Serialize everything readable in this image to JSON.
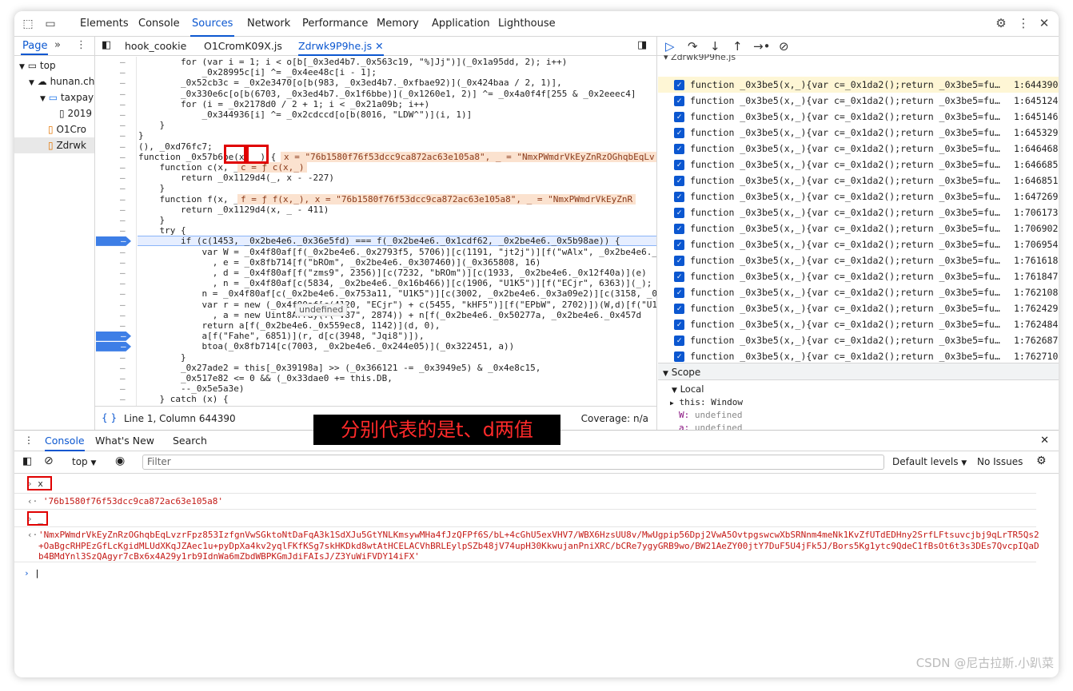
{
  "main_tabs": [
    "Elements",
    "Console",
    "Sources",
    "Network",
    "Performance",
    "Memory",
    "Application",
    "Lighthouse"
  ],
  "active_tab": "Sources",
  "navigator": {
    "tab": "Page",
    "tree": [
      "top",
      "hunan.ch",
      "taxpay",
      "2019",
      "O1Cro",
      "Zdrwk"
    ]
  },
  "editor_tabs": [
    "hook_cookie",
    "O1CromK09X.js",
    "Zdrwk9P9he.js"
  ],
  "code_lines": [
    "        for (var i = 1; i < o[b[_0x3ed4b7._0x563c19, \"%]Jj\")](_0x1a95dd, 2); i++)",
    "            _0x28995c[i] ^= _0x4ee48c[i - 1];",
    "        _0x52cb3c = _0x2e3470[o[b(983, _0x3ed4b7._0xfbae92)](_0x424baa / 2, 1)],",
    "        _0x330e6c[o[b(6703, _0x3ed4b7._0x1f6bbe)](_0x1260e1, 2)] ^= _0x4a0f4f[255 & _0x2eeec4]",
    "        for (i = _0x2178d0 / 2 + 1; i < _0x21a09b; i++)",
    "            _0x344936[i] ^= _0x2cdccd[o[b(8016, \"LDW^\")](i, 1)]",
    "    }",
    "}",
    "(), _0xd76fc7;",
    "function _0x57b6be(x, _) {",
    "    function c(x, _) {",
    "        return _0x1129d4(_, x - -227)",
    "    }",
    "    function f(x, _) {",
    "        return _0x1129d4(x, _ - 411)",
    "    }",
    "    try {",
    "        if (c(1453, _0x2be4e6._0x36e5fd) === f(_0x2be4e6._0x1cdf62, _0x2be4e6._0x5b98ae)) {",
    "            var W = _0x4f80af[f(_0x2be4e6._0x2793f5, 5706)][c(1191, \"jt2j\")][f(\"wAlx\", _0x2be4e6._0",
    "              , e = _0x8fb714[f(\"bROm\", _0x2be4e6._0x307460)](_0x365808, 16)",
    "              , d = _0x4f80af[f(\"zms9\", 2356)][c(7232, \"bROm\")][c(1933, _0x2be4e6._0x12f40a)](e)",
    "              , n = _0x4f80af[c(5834, _0x2be4e6._0x16b466)][c(1906, \"U1K5\")][f(\"ECjr\", 6363)](_);",
    "            n = _0x4f80af[c(_0x2be4e6._0x753a11, \"U1K5\")][c(3002, _0x2be4e6._0x3a09e2)][c(3158, _0",
    "            var r = new (_0x4f80af[c(4120, \"ECjr\") + c(5455, \"kHF5\")][f(\"EPbW\", 2702)])(W,d)[f(\"U1",
    "              , a = new Uint8Array(f(\"V87\", 2874)) + n[f(_0x2be4e6._0x50277a, _0x2be4e6._0x457d",
    "            return a[f(_0x2be4e6._0x559ec8, 1142)](d, 0),",
    "            a[f(\"Fahe\", 6851)](r, d[c(3948, \"Jqi8\")]),",
    "            btoa(_0x8fb714[c(7003, _0x2be4e6._0x244e05)](_0x322451, a))",
    "        }",
    "        _0x27ade2 = this[_0x39198a] >> (_0x366121 -= _0x3949e5) & _0x4e8c15,",
    "        _0x517e82 <= 0 && (_0x33dae0 += this.DB,",
    "        --_0x5e5a3e)",
    "    } catch (x) {",
    "        return \"\""
  ],
  "inline_values": {
    "fn_params": "x = \"76b1580f76f53dcc9ca872ac63e105a8\", _ = \"NmxPWmdrVkEyZnRzOGhqbEqLv",
    "c_def": "c = ƒ c(x,_)",
    "f_def": "f = ƒ f(x,_), x = \"76b1580f76f53dcc9ca872ac63e105a8\", _ = \"NmxPWmdrVkEyZnR"
  },
  "tooltip": "undefined",
  "status": {
    "position": "Line 1, Column 644390",
    "coverage": "Coverage: n/a"
  },
  "breakpoints_file": "Zdrwk9P9he.js",
  "breakpoints": [
    {
      "code": "function _0x3be5(x,_){var c=_0x1da2();return _0x3be5=funct…",
      "loc": "1:644390"
    },
    {
      "code": "function _0x3be5(x,_){var c=_0x1da2();return _0x3be5=funct…",
      "loc": "1:645124"
    },
    {
      "code": "function _0x3be5(x,_){var c=_0x1da2();return _0x3be5=funct…",
      "loc": "1:645146"
    },
    {
      "code": "function _0x3be5(x,_){var c=_0x1da2();return _0x3be5=funct…",
      "loc": "1:645329"
    },
    {
      "code": "function _0x3be5(x,_){var c=_0x1da2();return _0x3be5=funct…",
      "loc": "1:646468"
    },
    {
      "code": "function _0x3be5(x,_){var c=_0x1da2();return _0x3be5=funct…",
      "loc": "1:646685"
    },
    {
      "code": "function _0x3be5(x,_){var c=_0x1da2();return _0x3be5=funct…",
      "loc": "1:646851"
    },
    {
      "code": "function _0x3be5(x,_){var c=_0x1da2();return _0x3be5=funct…",
      "loc": "1:647269"
    },
    {
      "code": "function _0x3be5(x,_){var c=_0x1da2();return _0x3be5=funct…",
      "loc": "1:706173"
    },
    {
      "code": "function _0x3be5(x,_){var c=_0x1da2();return _0x3be5=funct…",
      "loc": "1:706902"
    },
    {
      "code": "function _0x3be5(x,_){var c=_0x1da2();return _0x3be5=funct…",
      "loc": "1:706954"
    },
    {
      "code": "function _0x3be5(x,_){var c=_0x1da2();return _0x3be5=funct…",
      "loc": "1:761618"
    },
    {
      "code": "function _0x3be5(x,_){var c=_0x1da2();return _0x3be5=funct…",
      "loc": "1:761847"
    },
    {
      "code": "function _0x3be5(x,_){var c=_0x1da2();return _0x3be5=funct…",
      "loc": "1:762108"
    },
    {
      "code": "function _0x3be5(x,_){var c=_0x1da2();return _0x3be5=funct…",
      "loc": "1:762429"
    },
    {
      "code": "function _0x3be5(x,_){var c=_0x1da2();return _0x3be5=funct…",
      "loc": "1:762484"
    },
    {
      "code": "function _0x3be5(x,_){var c=_0x1da2();return _0x3be5=funct…",
      "loc": "1:762687"
    },
    {
      "code": "function _0x3be5(x,_){var c=_0x1da2();return _0x3be5=funct…",
      "loc": "1:762710"
    }
  ],
  "scope": {
    "title": "Scope",
    "local": "Local",
    "vars": [
      {
        "name": "this:",
        "value": "Window"
      },
      {
        "name": "W:",
        "value": "undefined"
      },
      {
        "name": "a:",
        "value": "undefined"
      }
    ]
  },
  "drawer": {
    "tabs": [
      "Console",
      "What's New",
      "Search"
    ],
    "context": "top",
    "filter_placeholder": "Filter",
    "levels": "Default levels",
    "issues": "No Issues"
  },
  "console": {
    "in1": "x",
    "out1": "'76b1580f76f53dcc9ca872ac63e105a8'",
    "in2": "_",
    "out2": "'NmxPWmdrVkEyZnRzOGhqbEqLvzrFpz853IzfgnVwSGktoNtDaFqA3k1SdXJu5GtYNLKmsywMHa4fJzQFPf6S/bL+4cGhU5exVHV7/WBX6HzsUU8v/MwUgpip56Dpj2VwA5OvtpgswcwXbSRNnm4meNk1KvZfUTdEDHny2SrfLFtsuvcjbj9qLrTR5Qs2+OaBgcRHPEzGfLcKgidMLUdXKqJZAec1u+pyDpXa4kv2yqlFKfKSg7skHKDkd8wtAtHCELACVhBRLEylpSZb48jV74upH30KkwujanPniXRC/bCRe7ygyGRB9wo/BW21AeZY00jtY7DuF5U4jFk5J/Bors5Kg1ytc9QdeC1fBsOt6t3s3DEs7QvcpIQaDb4BMdYnl3SzQAgyr7cBx6x4A29y1rb9IdnWa6mZbdWBPKGmJdiFAIsJ/Z3YuWiFVDY14iFX'"
  },
  "annotation": "分别代表的是t、d两值",
  "watermark": "CSDN @尼古拉斯.小趴菜"
}
